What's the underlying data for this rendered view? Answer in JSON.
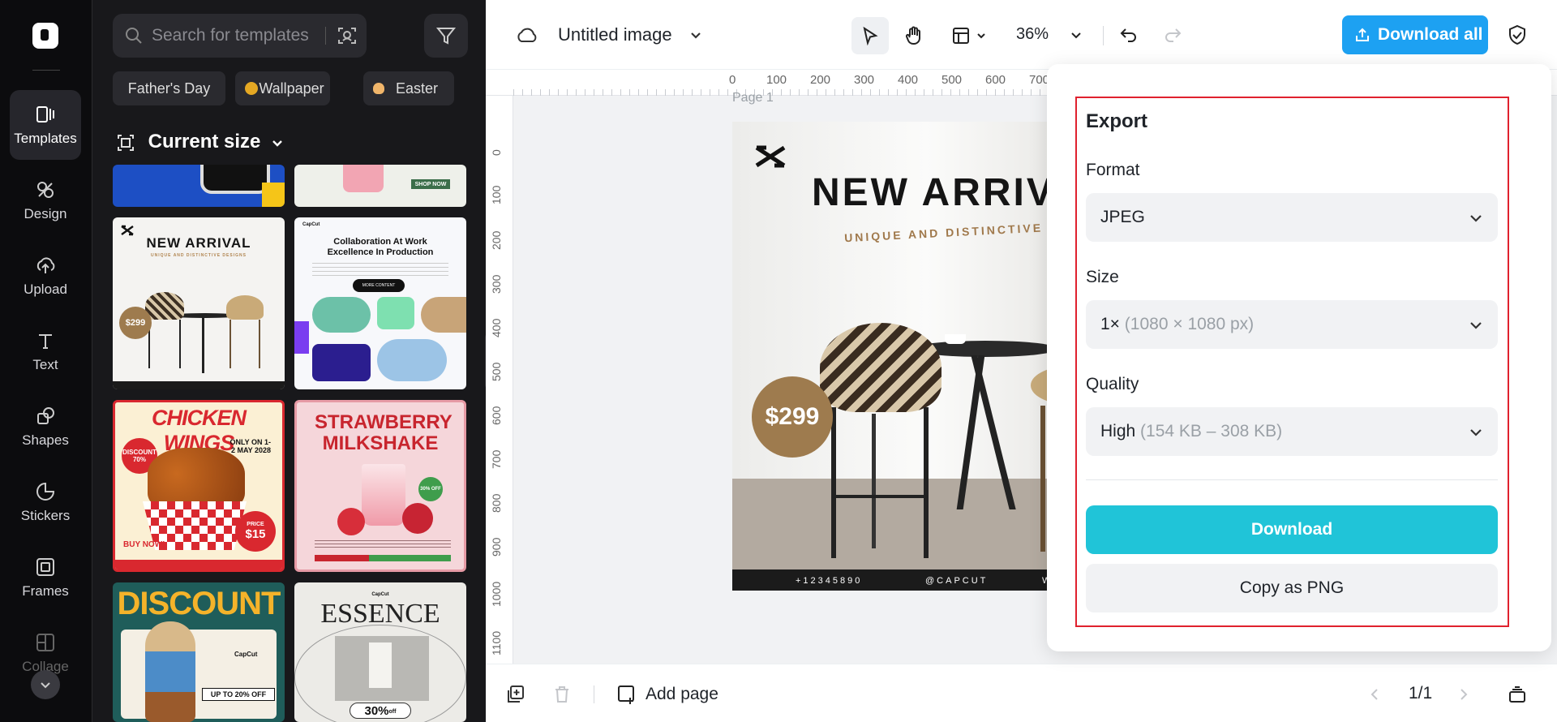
{
  "sidebar": {
    "items": [
      {
        "label": "Templates",
        "icon": "templates-icon"
      },
      {
        "label": "Design",
        "icon": "design-icon"
      },
      {
        "label": "Upload",
        "icon": "upload-icon"
      },
      {
        "label": "Text",
        "icon": "text-icon"
      },
      {
        "label": "Shapes",
        "icon": "shapes-icon"
      },
      {
        "label": "Stickers",
        "icon": "stickers-icon"
      },
      {
        "label": "Frames",
        "icon": "frames-icon"
      },
      {
        "label": "Collage",
        "icon": "collage-icon"
      }
    ]
  },
  "panel": {
    "search_placeholder": "Search for templates",
    "chips": [
      "Father's Day",
      "Wallpaper",
      "Easter"
    ],
    "current_size": "Current size",
    "templates": {
      "new_arrival": {
        "title": "NEW ARRIVAL",
        "subtitle": "UNIQUE AND DISTINCTIVE DESIGNS",
        "price": "$299"
      },
      "collab": {
        "brand": "CapCut",
        "title": "Collaboration At Work Excellence In Production",
        "button": "MORE CONTENT"
      },
      "wings": {
        "title": "CHICKEN WINGS",
        "discount": "DISCOUNT 70%",
        "date": "ONLY ON 1-2 MAY 2028",
        "price_label": "PRICE",
        "price": "$15",
        "cta": "BUY NOW!"
      },
      "milkshake": {
        "title": "STRAWBERRY MILKSHAKE",
        "badge": "30% OFF"
      },
      "discount": {
        "title": "DISCOUNT",
        "brand": "CapCut",
        "offer": "UP TO 20% OFF"
      },
      "essence": {
        "brand": "CapCut",
        "title": "ESSENCE",
        "offer": "30%",
        "offer_suffix": "off"
      },
      "partial_top_right": {
        "cta": "SHOP NOW"
      }
    }
  },
  "toolbar": {
    "title": "Untitled image",
    "zoom": "36%",
    "download_all": "Download all"
  },
  "canvas": {
    "page_label": "Page 1",
    "ruler_h": [
      "0",
      "100",
      "200",
      "300",
      "400",
      "500",
      "600",
      "700"
    ],
    "ruler_v": [
      "0",
      "100",
      "200",
      "300",
      "400",
      "500",
      "600",
      "700",
      "800",
      "900",
      "1000",
      "1100"
    ],
    "design": {
      "title": "NEW ARRIV",
      "subtitle": "UNIQUE AND DISTINCTIVE DE",
      "price": "$299",
      "footer": [
        "+12345890",
        "@CAPCUT",
        "W"
      ]
    }
  },
  "export": {
    "title": "Export",
    "format_label": "Format",
    "format_value": "JPEG",
    "size_label": "Size",
    "size_value": "1×",
    "size_detail": "(1080 × 1080 px)",
    "quality_label": "Quality",
    "quality_value": "High",
    "quality_detail": "(154 KB – 308 KB)",
    "download": "Download",
    "copy_png": "Copy as PNG"
  },
  "bottom": {
    "add_page": "Add page",
    "page_count": "1/1"
  },
  "colors": {
    "accent": "#20c4d8",
    "download_all": "#1da1f2",
    "highlight": "#e0212e",
    "panel_bg": "#18181b"
  }
}
